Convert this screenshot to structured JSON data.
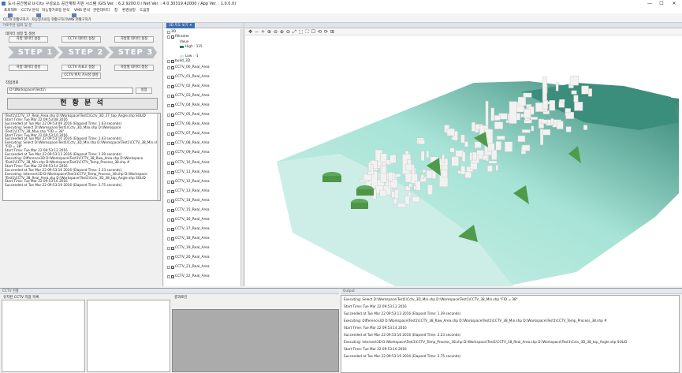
{
  "window": {
    "title": "도시·공간정보 U-City 구성요소 공간계획 지원 시스템 (GIS Ver. : 6.2.9200.0 / Net Ver. : 4.0.30319.42000 / App Ver. : 1.0.0.0)",
    "minimize": "—",
    "maximize": "☐",
    "close": "✕"
  },
  "menubar": [
    "프로젝트",
    "CCTV 분석",
    "자능형가로등 분석",
    "VMS 분석",
    "관련데이터",
    "창",
    "환경설정",
    "도움말"
  ],
  "toolbar": [
    "CCTV 현황구하기",
    "자능형가로등 현황구하기",
    "VMS 현황구하기"
  ],
  "left_panel": {
    "header": "가로주변 범죄 및 분",
    "data_group_label": "데이터 설정 및 생성",
    "buttons_row1": [
      "자방 데이터 설정",
      "CCTV 데이터 설정",
      "자방별 데이터 설정"
    ],
    "steps": [
      "STEP 1",
      "STEP 2",
      "STEP 3"
    ],
    "buttons_row2": [
      "자방 데이터 생성",
      "CCTV 자표고 설정",
      "자방별 데이터 생성"
    ],
    "button_visibility": "CCTV 위치 가시성 생성",
    "workpath_label": "작업경로",
    "workpath_value": "D:\\Workspace\\Test1\\",
    "workpath_button": "설정",
    "run_button": "현 황 분 석",
    "log_lines": [
      "\\Test1\\CCTV_37_Real_Area.shp D:\\Workspace\\Test1\\Cctv_3D_37_top_Angle.shp SOLID",
      "Start Time: Tue Mar 22 09:53:08 2016",
      "Succeeded at Tue Mar 22 09:53:09 2016 (Elapsed Time: 1.63 seconds)",
      "Executing: Select D:\\Workspace\\Test1\\Cctv_3D_Max.shp D:\\Workspace",
      "\\Test1\\CCTV_38_Max.shp \"FID = 38\"",
      "Start Time: Tue Mar 22 09:53:10 2016",
      "Succeeded at Tue Mar 22 09:53:10 2016 (Elapsed Time: 1.43 seconds)",
      "Executing: Select D:\\Workspace\\Test1\\Cctv_3D_Min.shp D:\\Workspace\\Test1\\CCTV_38_Min.shp",
      "\"FID = 38\"",
      "Start Time: Tue Mar 22 09:53:12 2016",
      "Succeeded at Tue Mar 22 09:53:13 2016 (Elapsed Time: 1.39 seconds)",
      "Executing: Difference3D D:\\Workspace\\Test1\\CCTV_38_Raw_Area.shp D:\\Workspace",
      "\\Test1\\CCTV_38_Min.shp D:\\Workspace\\Test1\\CCTV_Temp_Process_38.shp #",
      "Start Time: Tue Mar 22 09:53:14 2016",
      "Succeeded at Tue Mar 22 09:53:16 2016 (Elapsed Time: 2.23 seconds)",
      "Executing: Intersect3D D:\\Workspace\\Test1\\CCTV_Temp_Process_38.shp D:\\Workspace",
      "\\Test1\\CCTV_38_Real_Area.shp D:\\Workspace\\Test1\\Cctv_3D_38_top_Angle.shp SOLID",
      "Start Time: Tue Mar 22 09:53:16 2016",
      "Succeeded at Tue Mar 22 09:53:19 2016 (Elapsed Time: 2.75 seconds)"
    ]
  },
  "layer_panel": {
    "tab": "3D 지도 보기",
    "root_label": "3D",
    "raster_layer": "fillraster",
    "legend_value": "Value",
    "legend_high": "High : 115",
    "legend_low": "Low : -1",
    "building_layer": "build_3D",
    "layers": [
      "CCTV_00_Real_Area",
      "CCTV_01_Real_Area",
      "CCTV_02_Real_Area",
      "CCTV_03_Real_Area",
      "CCTV_04_Real_Area",
      "CCTV_05_Real_Area",
      "CCTV_06_Real_Area",
      "CCTV_07_Real_Area",
      "CCTV_08_Real_Area",
      "CCTV_09_Real_Area",
      "CCTV_10_Real_Area",
      "CCTV_11_Real_Area",
      "CCTV_12_Real_Area",
      "CCTV_13_Real_Area",
      "CCTV_14_Real_Area",
      "CCTV_15_Real_Area",
      "CCTV_16_Real_Area",
      "CCTV_17_Real_Area",
      "CCTV_18_Real_Area",
      "CCTV_19_Real_Area",
      "CCTV_20_Real_Area",
      "CCTV_21_Real_Area",
      "CCTV_22_Real_Area"
    ]
  },
  "map_tools": [
    "✥",
    "−",
    "+",
    "⊕",
    "⊖",
    "⊕",
    "⊖",
    "⤢",
    "⬚",
    "⛶",
    "☐",
    "⟲",
    "⟳",
    "⊞"
  ],
  "bottom": {
    "left_header": "CCTV 현황",
    "left_sub_label": "유지된 CCTV 지점 목록",
    "analysis_label": "결과로인",
    "output_header": "Output",
    "output_lines": [
      "Executing: Select D:\\Workspace\\Test1\\Cctv_3D_Min.shp D:\\Workspace\\Test1\\CCTV_38_Min.shp \"FID = 38\"",
      "Start Time: Tue Mar 22 09:53:12 2016",
      "Succeeded at Tue Mar 22 09:53:13 2016 (Elapsed Time: 1.39 seconds)",
      "Executing: Difference3D D:\\Workspace\\Test1\\CCTV_38_Raw_Area.shp D:\\Workspace\\Test1\\CCTV_38_Min.shp D:\\Workspace\\Test1\\CCTV_Temp_Process_38.shp #",
      "Start Time: Tue Mar 22 09:53:14 2016",
      "Succeeded at Tue Mar 22 09:53:16 2016 (Elapsed Time: 2.23 seconds)",
      "Executing: Intersect3D D:\\Workspace\\Test1\\CCTV_Temp_Process_38.shp D:\\Workspace\\Test1\\CCTV_38_Real_Area.shp D:\\Workspace\\Test1\\Cctv_3D_38_top_Angle.shp SOLID",
      "Start Time: Tue Mar 22 09:53:16 2016",
      "Succeeded at Tue Mar 22 09:53:19 2016 (Elapsed Time: 2.75 seconds)"
    ]
  },
  "colors": {
    "step_arrow": "#b9bcc0",
    "legend_high": "#1f7a68",
    "legend_low": "#c9efe7",
    "terrain_light": "#bdeee4",
    "terrain_dark": "#2e7f6e",
    "coverage_green": "#5fa85a",
    "building": "#f2f2f2"
  }
}
